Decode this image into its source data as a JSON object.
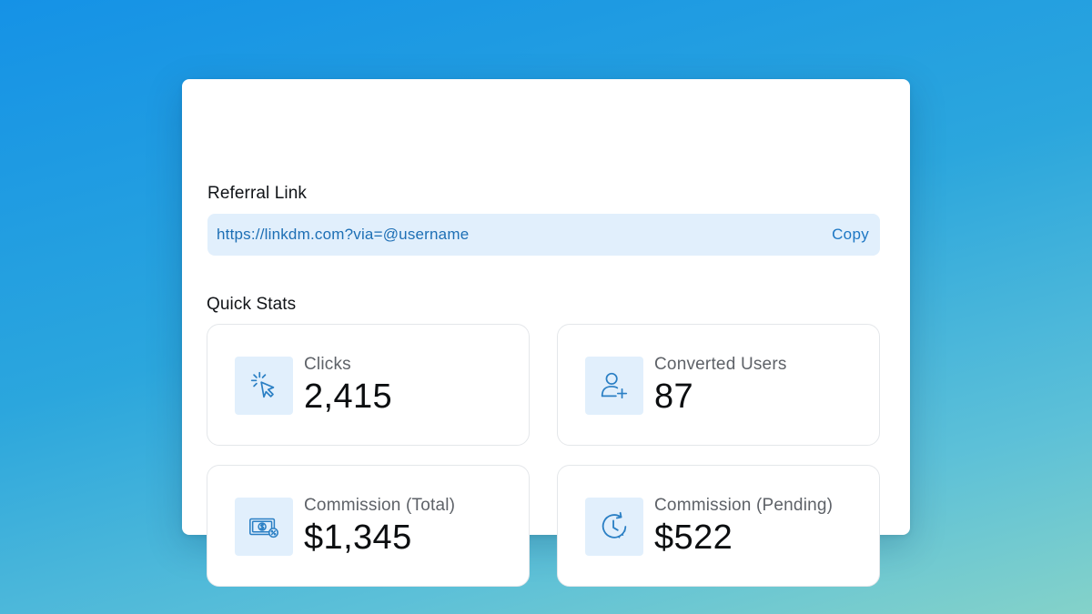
{
  "referral": {
    "label": "Referral Link",
    "url": "https://linkdm.com?via=@username",
    "copy_label": "Copy"
  },
  "quick_stats": {
    "label": "Quick Stats",
    "items": [
      {
        "title": "Clicks",
        "value": "2,415",
        "icon": "cursor-click-icon"
      },
      {
        "title": "Converted Users",
        "value": "87",
        "icon": "user-add-icon"
      },
      {
        "title": "Commission (Total)",
        "value": "$1,345",
        "icon": "money-commission-icon"
      },
      {
        "title": "Commission (Pending)",
        "value": "$522",
        "icon": "clock-pending-icon"
      }
    ]
  },
  "colors": {
    "accent": "#1d77c4",
    "icon_bg": "#e1effc",
    "link_bar_bg": "#e1effc"
  }
}
